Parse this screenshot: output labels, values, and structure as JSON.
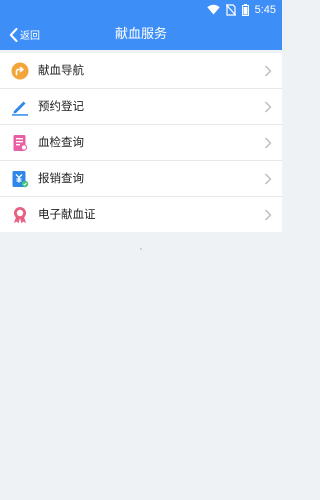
{
  "status_bar": {
    "time": "5:45",
    "icons": [
      "wifi-icon",
      "no-sim-icon",
      "battery-icon"
    ]
  },
  "header": {
    "back_label": "返回",
    "title": "献血服务"
  },
  "menu": {
    "items": [
      {
        "label": "献血导航",
        "icon": "navigation-icon"
      },
      {
        "label": "预约登记",
        "icon": "pencil-icon"
      },
      {
        "label": "血检查询",
        "icon": "document-search-icon"
      },
      {
        "label": "报销查询",
        "icon": "reimbursement-icon"
      },
      {
        "label": "电子献血证",
        "icon": "certificate-badge-icon"
      }
    ]
  },
  "colors": {
    "accent": "#3e8ef7",
    "background": "#eff2f5"
  }
}
